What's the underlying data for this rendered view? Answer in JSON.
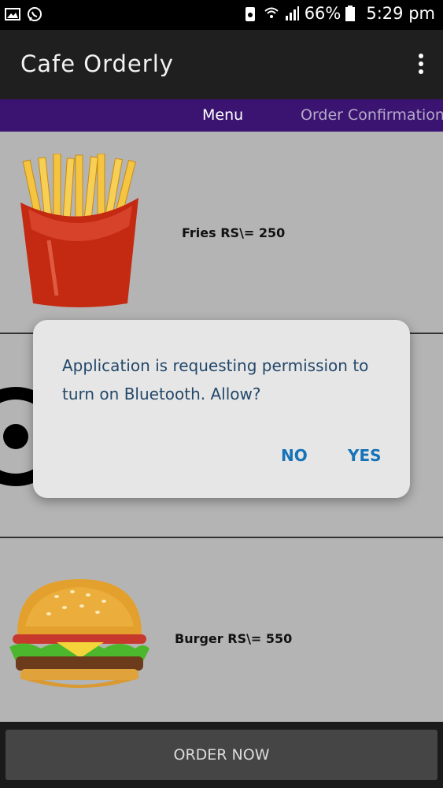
{
  "status_bar": {
    "battery": "66%",
    "time": "5:29 pm"
  },
  "app_bar": {
    "title": "Cafe Orderly"
  },
  "tabs": [
    {
      "label": "Menu"
    },
    {
      "label": "Order Confirmation"
    }
  ],
  "menu_items": [
    {
      "label": "Fries RS\\= 250"
    },
    {
      "label": "Burger RS\\= 550"
    }
  ],
  "dialog": {
    "message": "Application is requesting permission to turn on Bluetooth. Allow?",
    "no_label": "NO",
    "yes_label": "YES"
  },
  "order_button": {
    "label": "ORDER NOW"
  },
  "colors": {
    "tab_bar": "#3a1470",
    "app_bar": "#1f1f1f",
    "dialog_text": "#23486a",
    "dialog_button": "#1573b8"
  }
}
